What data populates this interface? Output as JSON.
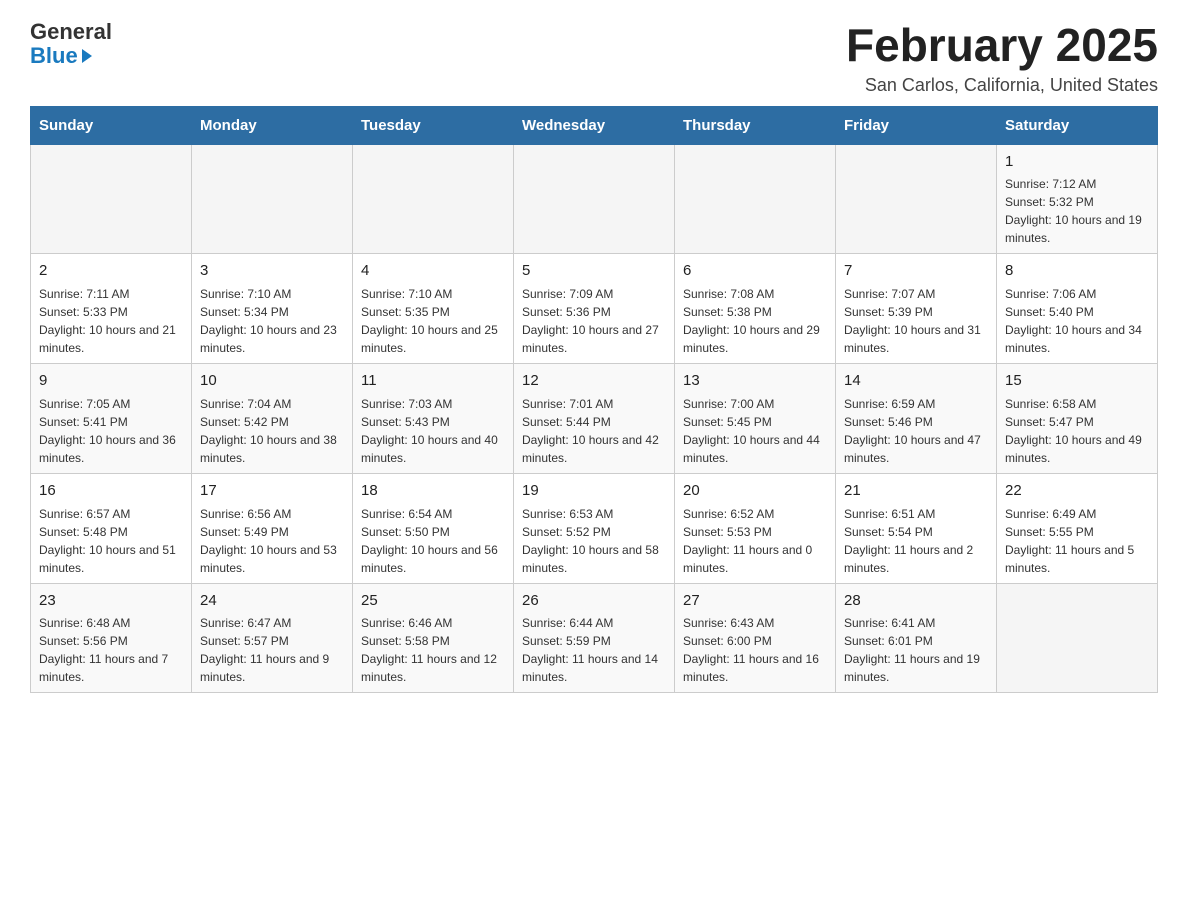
{
  "header": {
    "logo_general": "General",
    "logo_blue": "Blue",
    "month_title": "February 2025",
    "location": "San Carlos, California, United States"
  },
  "days_of_week": [
    "Sunday",
    "Monday",
    "Tuesday",
    "Wednesday",
    "Thursday",
    "Friday",
    "Saturday"
  ],
  "weeks": [
    {
      "row_class": "week-row-1",
      "days": [
        {
          "num": "",
          "info": ""
        },
        {
          "num": "",
          "info": ""
        },
        {
          "num": "",
          "info": ""
        },
        {
          "num": "",
          "info": ""
        },
        {
          "num": "",
          "info": ""
        },
        {
          "num": "",
          "info": ""
        },
        {
          "num": "1",
          "info": "Sunrise: 7:12 AM\nSunset: 5:32 PM\nDaylight: 10 hours and 19 minutes."
        }
      ]
    },
    {
      "row_class": "week-row-2",
      "days": [
        {
          "num": "2",
          "info": "Sunrise: 7:11 AM\nSunset: 5:33 PM\nDaylight: 10 hours and 21 minutes."
        },
        {
          "num": "3",
          "info": "Sunrise: 7:10 AM\nSunset: 5:34 PM\nDaylight: 10 hours and 23 minutes."
        },
        {
          "num": "4",
          "info": "Sunrise: 7:10 AM\nSunset: 5:35 PM\nDaylight: 10 hours and 25 minutes."
        },
        {
          "num": "5",
          "info": "Sunrise: 7:09 AM\nSunset: 5:36 PM\nDaylight: 10 hours and 27 minutes."
        },
        {
          "num": "6",
          "info": "Sunrise: 7:08 AM\nSunset: 5:38 PM\nDaylight: 10 hours and 29 minutes."
        },
        {
          "num": "7",
          "info": "Sunrise: 7:07 AM\nSunset: 5:39 PM\nDaylight: 10 hours and 31 minutes."
        },
        {
          "num": "8",
          "info": "Sunrise: 7:06 AM\nSunset: 5:40 PM\nDaylight: 10 hours and 34 minutes."
        }
      ]
    },
    {
      "row_class": "week-row-3",
      "days": [
        {
          "num": "9",
          "info": "Sunrise: 7:05 AM\nSunset: 5:41 PM\nDaylight: 10 hours and 36 minutes."
        },
        {
          "num": "10",
          "info": "Sunrise: 7:04 AM\nSunset: 5:42 PM\nDaylight: 10 hours and 38 minutes."
        },
        {
          "num": "11",
          "info": "Sunrise: 7:03 AM\nSunset: 5:43 PM\nDaylight: 10 hours and 40 minutes."
        },
        {
          "num": "12",
          "info": "Sunrise: 7:01 AM\nSunset: 5:44 PM\nDaylight: 10 hours and 42 minutes."
        },
        {
          "num": "13",
          "info": "Sunrise: 7:00 AM\nSunset: 5:45 PM\nDaylight: 10 hours and 44 minutes."
        },
        {
          "num": "14",
          "info": "Sunrise: 6:59 AM\nSunset: 5:46 PM\nDaylight: 10 hours and 47 minutes."
        },
        {
          "num": "15",
          "info": "Sunrise: 6:58 AM\nSunset: 5:47 PM\nDaylight: 10 hours and 49 minutes."
        }
      ]
    },
    {
      "row_class": "week-row-4",
      "days": [
        {
          "num": "16",
          "info": "Sunrise: 6:57 AM\nSunset: 5:48 PM\nDaylight: 10 hours and 51 minutes."
        },
        {
          "num": "17",
          "info": "Sunrise: 6:56 AM\nSunset: 5:49 PM\nDaylight: 10 hours and 53 minutes."
        },
        {
          "num": "18",
          "info": "Sunrise: 6:54 AM\nSunset: 5:50 PM\nDaylight: 10 hours and 56 minutes."
        },
        {
          "num": "19",
          "info": "Sunrise: 6:53 AM\nSunset: 5:52 PM\nDaylight: 10 hours and 58 minutes."
        },
        {
          "num": "20",
          "info": "Sunrise: 6:52 AM\nSunset: 5:53 PM\nDaylight: 11 hours and 0 minutes."
        },
        {
          "num": "21",
          "info": "Sunrise: 6:51 AM\nSunset: 5:54 PM\nDaylight: 11 hours and 2 minutes."
        },
        {
          "num": "22",
          "info": "Sunrise: 6:49 AM\nSunset: 5:55 PM\nDaylight: 11 hours and 5 minutes."
        }
      ]
    },
    {
      "row_class": "week-row-5",
      "days": [
        {
          "num": "23",
          "info": "Sunrise: 6:48 AM\nSunset: 5:56 PM\nDaylight: 11 hours and 7 minutes."
        },
        {
          "num": "24",
          "info": "Sunrise: 6:47 AM\nSunset: 5:57 PM\nDaylight: 11 hours and 9 minutes."
        },
        {
          "num": "25",
          "info": "Sunrise: 6:46 AM\nSunset: 5:58 PM\nDaylight: 11 hours and 12 minutes."
        },
        {
          "num": "26",
          "info": "Sunrise: 6:44 AM\nSunset: 5:59 PM\nDaylight: 11 hours and 14 minutes."
        },
        {
          "num": "27",
          "info": "Sunrise: 6:43 AM\nSunset: 6:00 PM\nDaylight: 11 hours and 16 minutes."
        },
        {
          "num": "28",
          "info": "Sunrise: 6:41 AM\nSunset: 6:01 PM\nDaylight: 11 hours and 19 minutes."
        },
        {
          "num": "",
          "info": ""
        }
      ]
    }
  ]
}
